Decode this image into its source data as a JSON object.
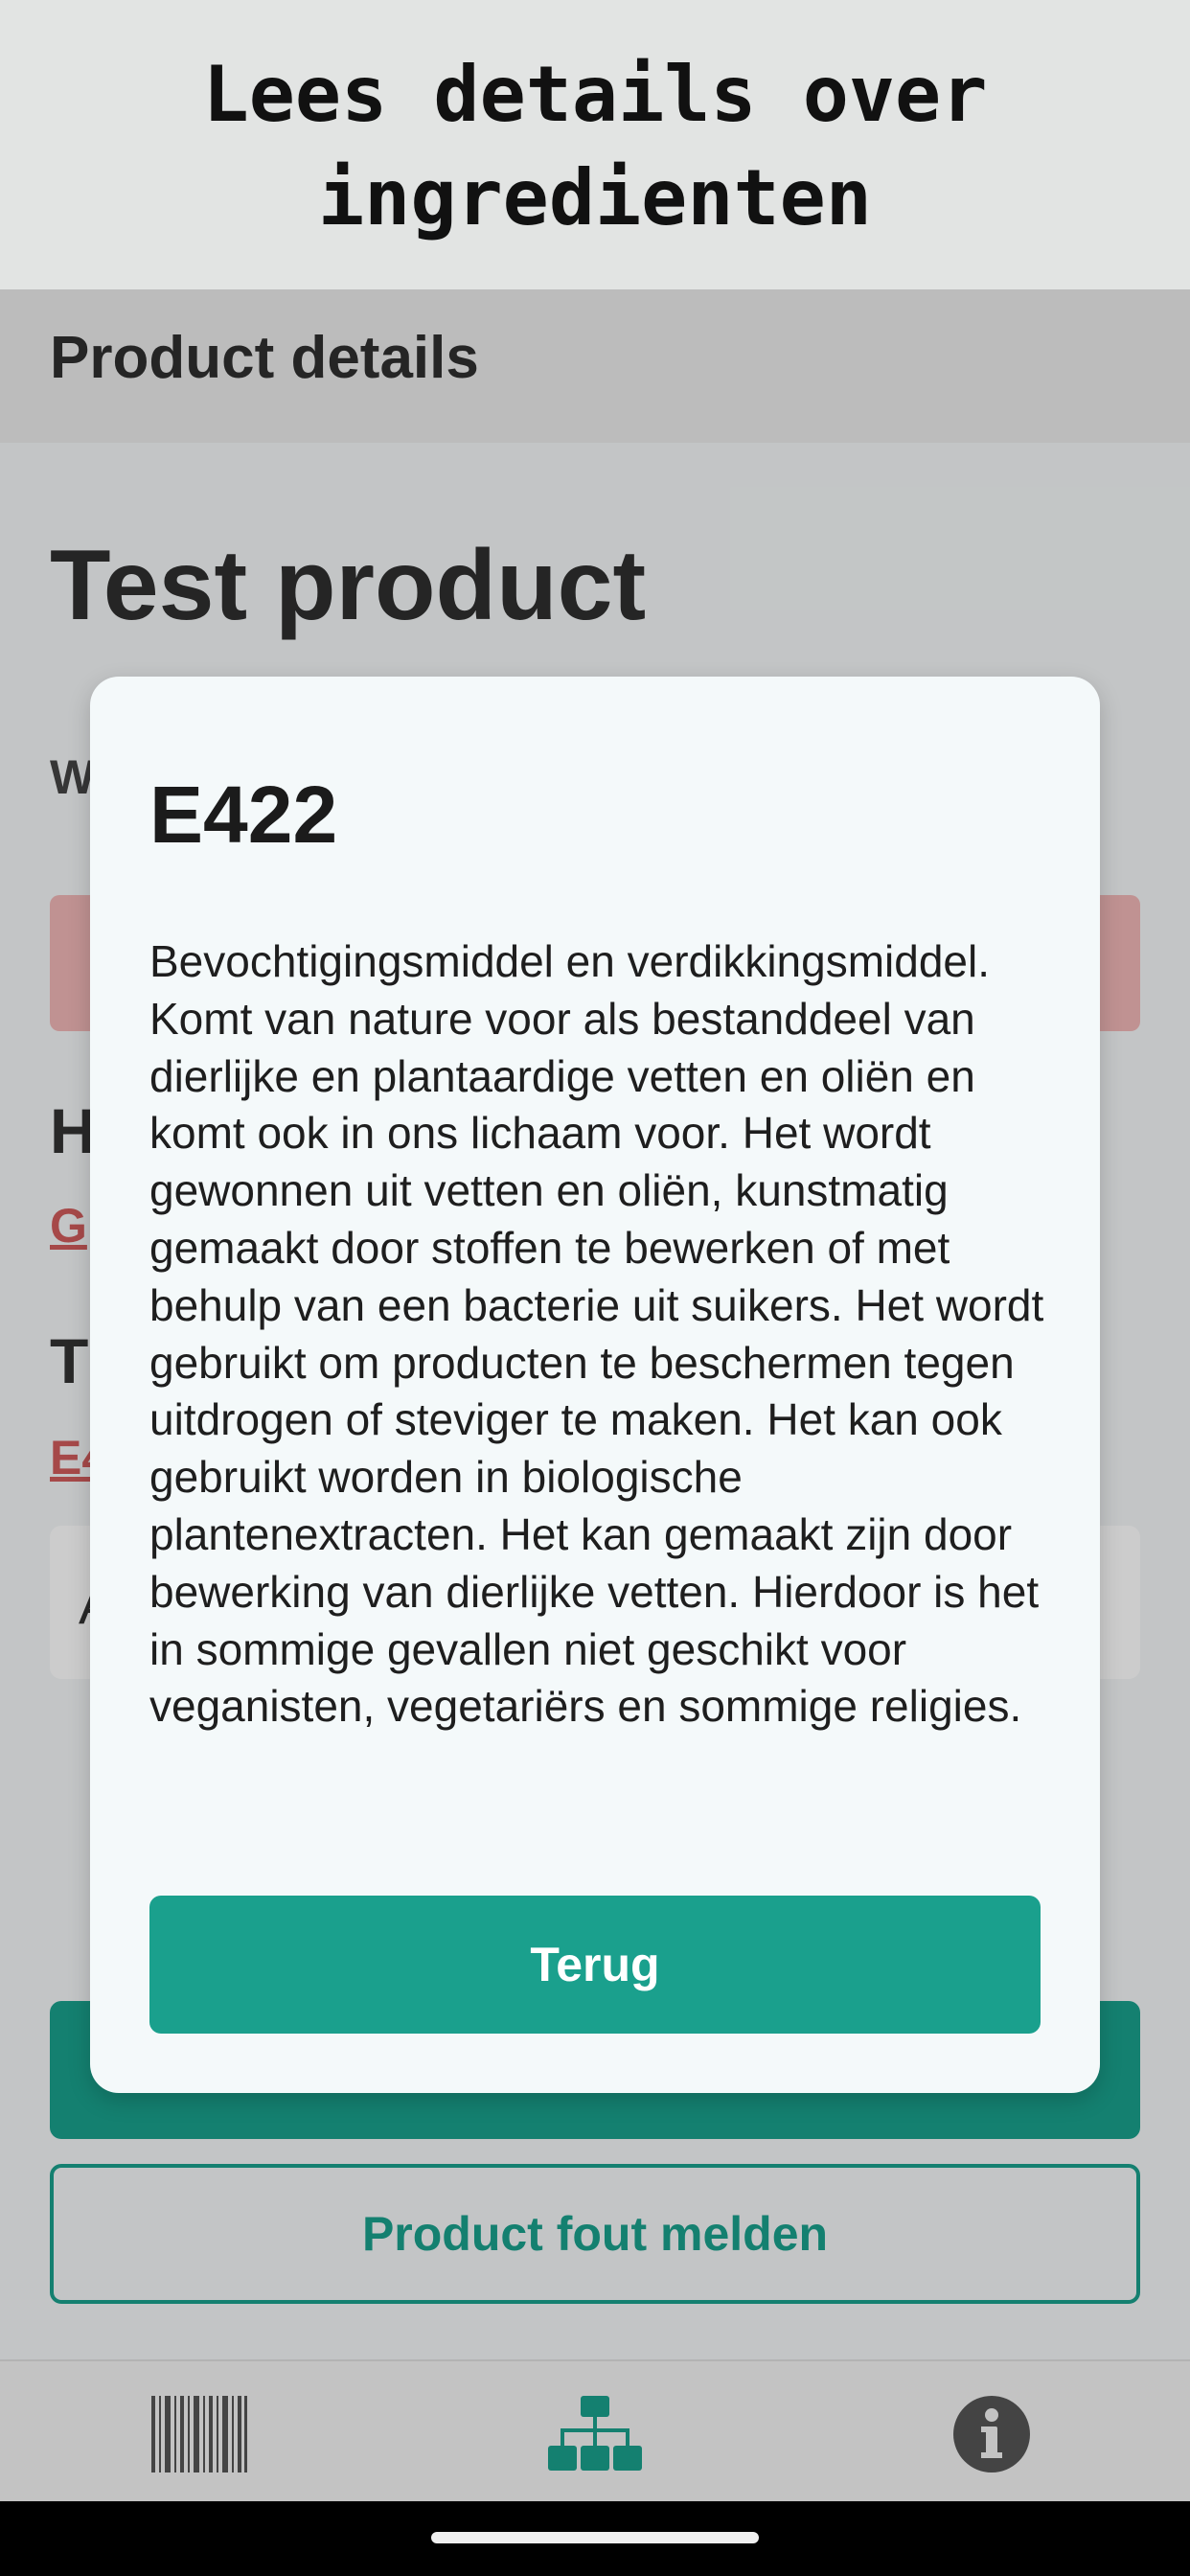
{
  "caption": {
    "line1": "Lees details over",
    "line2": "ingredienten"
  },
  "screen": {
    "appbar_title": "Product details",
    "product_name": "Test product",
    "warning_label": "W",
    "section1_head": "H",
    "section1_link": "G",
    "section2_head": "T",
    "section2_link": "E4",
    "card_letter": "A",
    "report_button": "Product fout melden"
  },
  "bottom_nav": {
    "items": [
      {
        "icon": "barcode-icon"
      },
      {
        "icon": "hierarchy-icon"
      },
      {
        "icon": "info-icon"
      }
    ]
  },
  "dialog": {
    "title": "E422",
    "body": "Bevochtigingsmiddel en verdikkingsmiddel. Komt van nature voor als bestanddeel van dierlijke en plantaardige vetten en oliën en komt ook in ons lichaam voor. Het wordt gewonnen uit vetten en oliën, kunstmatig gemaakt door stoffen te bewerken of met behulp van een bacterie uit suikers. Het wordt gebruikt om producten te beschermen tegen uitdrogen of steviger te maken. Het kan ook gebruikt worden in biologische plantenextracten. Het kan gemaakt zijn door bewerking van dierlijke vetten. Hierdoor is het in sommige gevallen niet geschikt voor veganisten, vegetariërs en sommige religies.",
    "button": "Terug"
  },
  "colors": {
    "accent": "#1aa08d",
    "warning": "#f1b7b7",
    "link": "#d05c5c"
  }
}
